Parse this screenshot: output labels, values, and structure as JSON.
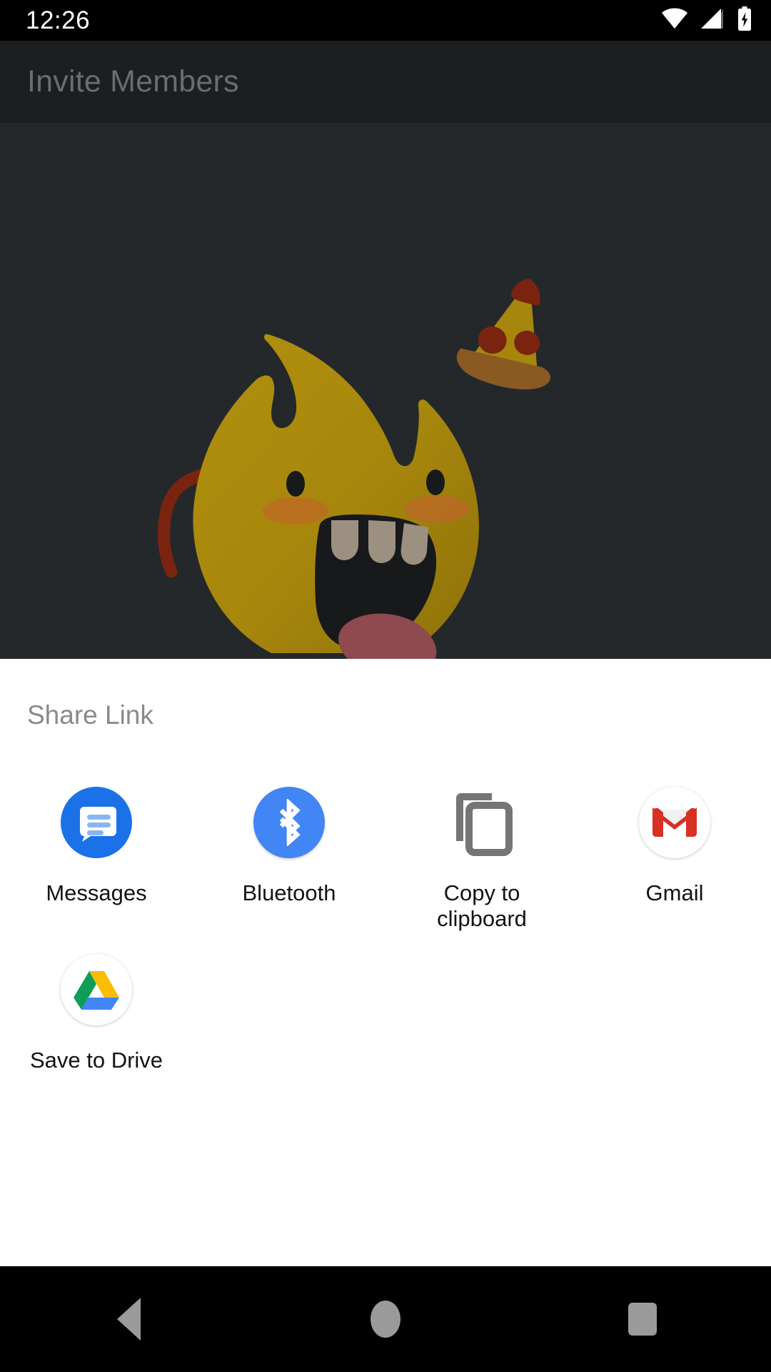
{
  "status_bar": {
    "time": "12:26",
    "icons": [
      "wifi-icon",
      "cellular-signal-icon",
      "battery-charging-icon"
    ]
  },
  "toolbar": {
    "title": "Invite Members"
  },
  "content": {
    "illustration_name": "flame-monster-with-pizza-illustration",
    "background_color": "#24282b",
    "mascot_color": "#a6860c",
    "pizza_color": "#a6860c",
    "arm_color": "#7a2410"
  },
  "share_sheet": {
    "title": "Share Link",
    "background_color": "#ffffff",
    "targets": [
      {
        "label": "Messages",
        "icon": "google-messages-icon",
        "color": "#1b72e8"
      },
      {
        "label": "Bluetooth",
        "icon": "bluetooth-icon",
        "color": "#4285f4"
      },
      {
        "label": "Copy to clipboard",
        "icon": "copy-to-clipboard-icon",
        "color": "#757575"
      },
      {
        "label": "Gmail",
        "icon": "gmail-icon",
        "color": "#d93025"
      },
      {
        "label": "Save to Drive",
        "icon": "google-drive-icon",
        "color": "#0f9d58"
      }
    ]
  },
  "nav_bar": {
    "back_label": "Back",
    "home_label": "Home",
    "recents_label": "Recents",
    "background_color": "#000000",
    "icon_color": "#9a9a9a"
  }
}
